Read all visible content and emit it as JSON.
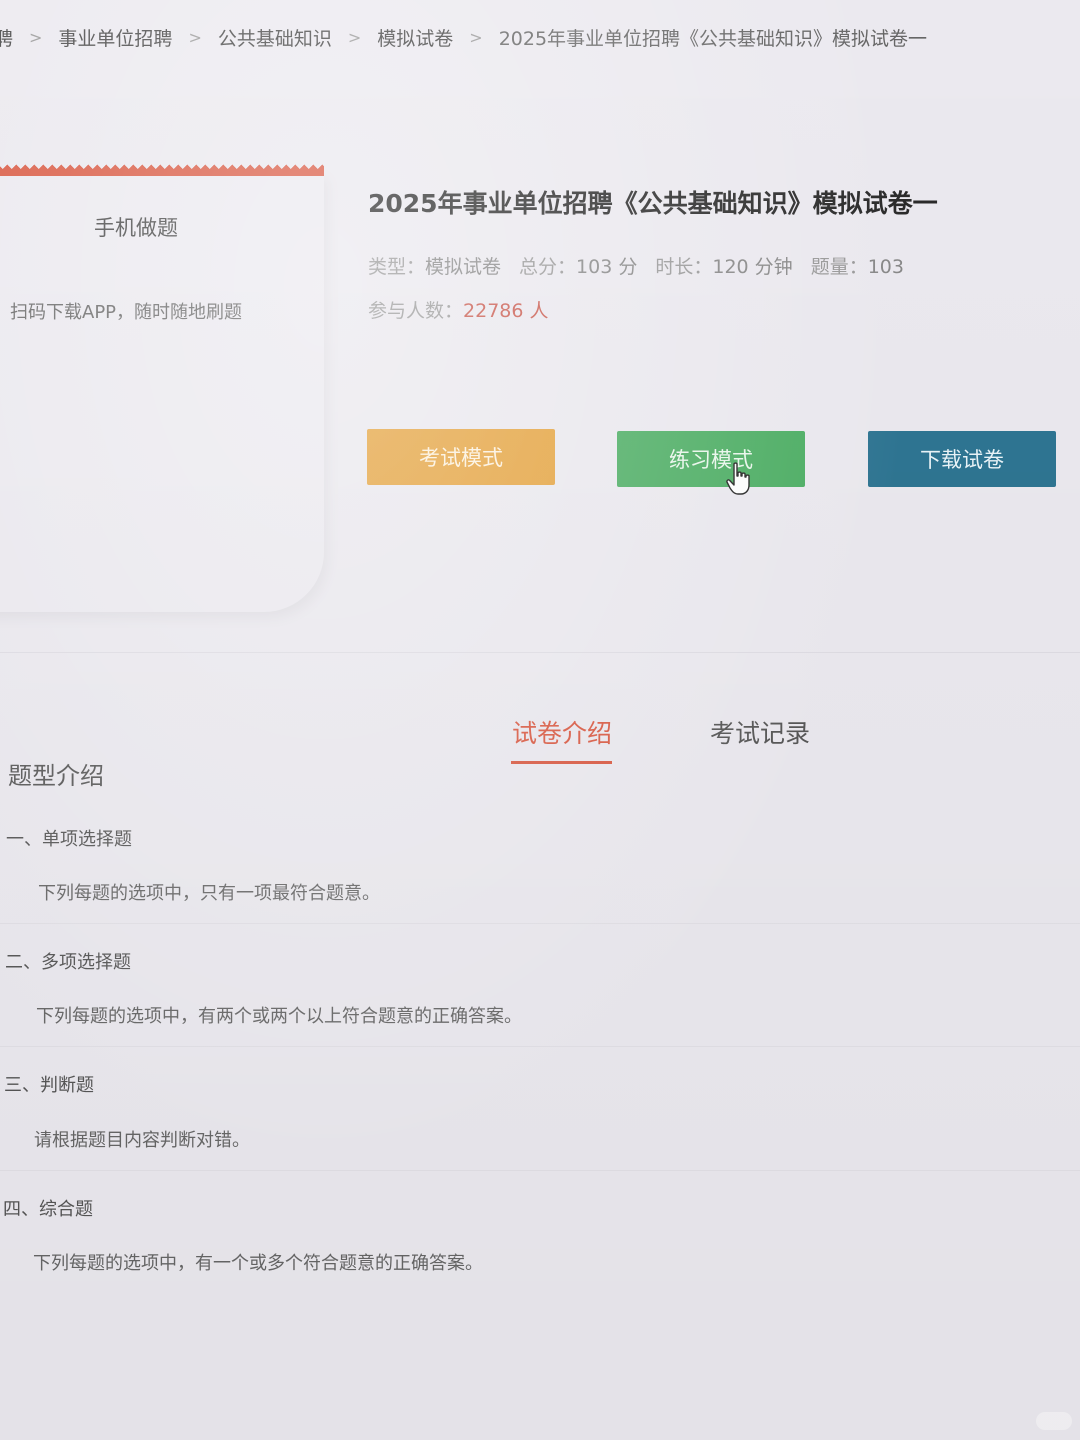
{
  "breadcrumb": {
    "items": [
      "聘",
      "事业单位招聘",
      "公共基础知识",
      "模拟试卷",
      "2025年事业单位招聘《公共基础知识》模拟试卷一"
    ],
    "separator": ">"
  },
  "mobile_card": {
    "title": "手机做题",
    "description": "扫码下载APP，随时随地刷题"
  },
  "exam": {
    "title": "2025年事业单位招聘《公共基础知识》模拟试卷一",
    "type_label": "类型：",
    "type_value": "模拟试卷",
    "score_label": "总分：",
    "score_value": "103 分",
    "duration_label": "时长：",
    "duration_value": "120 分钟",
    "count_label": "题量：",
    "count_value": "103",
    "participants_label": "参与人数：",
    "participants_value": "22786 人"
  },
  "buttons": {
    "exam_mode": "考试模式",
    "practice_mode": "练习模式",
    "download": "下载试卷"
  },
  "tabs": {
    "intro": "试卷介绍",
    "record": "考试记录"
  },
  "content": {
    "heading": "题型介绍",
    "sections": [
      {
        "title": "一、单项选择题",
        "desc": "下列每题的选项中，只有一项最符合题意。"
      },
      {
        "title": "二、多项选择题",
        "desc": "下列每题的选项中，有两个或两个以上符合题意的正确答案。"
      },
      {
        "title": "三、判断题",
        "desc": "请根据题目内容判断对错。"
      },
      {
        "title": "四、综合题",
        "desc": "下列每题的选项中，有一个或多个符合题意的正确答案。"
      }
    ]
  },
  "colors": {
    "accent": "#d9563f",
    "exam_button": "#e5a23b",
    "practice_button": "#4cae63",
    "download_button": "#2e7592",
    "participants_number": "#c9584c"
  },
  "icons": {
    "cursor": "hand-pointer-icon"
  }
}
